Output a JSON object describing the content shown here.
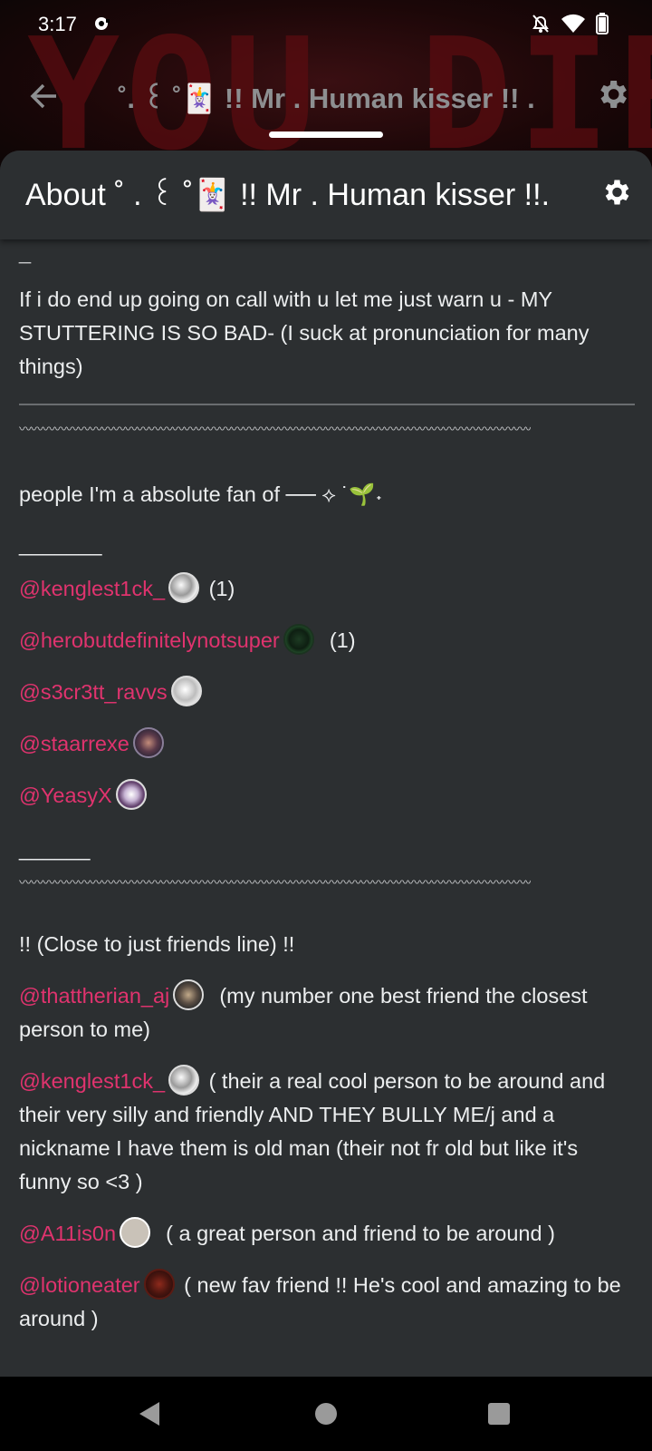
{
  "status": {
    "time": "3:17"
  },
  "background_banner": {
    "text": "YOU DIED!"
  },
  "top_bar": {
    "title": "˚. ꒰ ˚🃏 !! Mr . Human kisser !! ."
  },
  "sheet": {
    "title": "About ˚ . ꒰ ˚🃏 !! Mr . Human kisser !!..."
  },
  "content": {
    "dash_top": "_",
    "warning": "If i do end up going on call with u let me just warn u - MY STUTTERING IS SO BAD- (I suck at pronunciation for many things)",
    "wavy_line": "〰〰〰〰〰〰〰〰〰〰〰〰〰〰〰〰〰〰〰〰〰〰〰〰〰〰〰〰〰〰〰〰〰〰〰〰〰〰〰〰〰〰〰〰",
    "fans_heading": "people I'm a absolute fan of ── ⟡ ˙🌱˖",
    "underscores_1": "_______",
    "fans": [
      {
        "handle": "@kenglest1ck_",
        "note": "(1)"
      },
      {
        "handle": "@herobutdefinitelynotsuper",
        "note": "(1)"
      },
      {
        "handle": "@s3cr3tt_ravvs",
        "note": ""
      },
      {
        "handle": "@staarrexe",
        "note": ""
      },
      {
        "handle": "@YeasyX",
        "note": ""
      }
    ],
    "underscores_2": "______",
    "friends_heading": "!! (Close to just friends line) !!",
    "friends": [
      {
        "handle": "@thattherian_aj",
        "note": "(my number one best friend the closest person to me)"
      },
      {
        "handle": "@kenglest1ck_",
        "note": "( their a real cool person to be around and their very silly and friendly AND THEY BULLY ME/j and  a nickname I have them is old man (their not fr old but like it's funny so <3 )"
      },
      {
        "handle": "@A11is0n",
        "note": "( a great person and friend to be around )"
      },
      {
        "handle": "@lotioneater",
        "note": "( new fav friend !! He's cool and amazing to be around )"
      }
    ]
  },
  "icons": {
    "back": "arrow-left-icon",
    "settings": "gear-icon",
    "nav": [
      "back-triangle-icon",
      "home-circle-icon",
      "recents-square-icon"
    ]
  }
}
